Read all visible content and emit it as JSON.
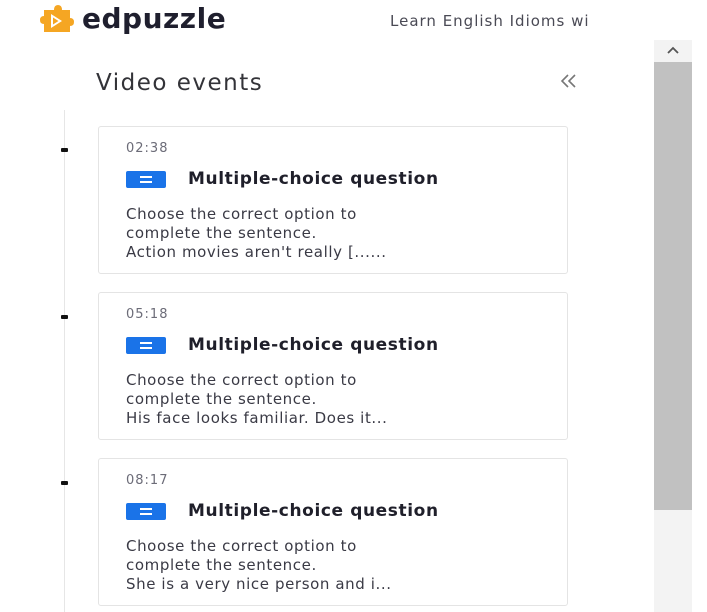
{
  "header": {
    "logo_text": "edpuzzle",
    "video_title": "Learn English Idioms wi"
  },
  "panel": {
    "title": "Video events"
  },
  "events": [
    {
      "time": "02:38",
      "type_label": "Multiple-choice question",
      "line1": "Choose the correct option to",
      "line2": "complete the sentence.",
      "line3": "Action movies aren't really [......"
    },
    {
      "time": "05:18",
      "type_label": "Multiple-choice question",
      "line1": "Choose the correct option to",
      "line2": "complete the sentence.",
      "line3": "His face looks familiar. Does it..."
    },
    {
      "time": "08:17",
      "type_label": "Multiple-choice question",
      "line1": "Choose the correct option to",
      "line2": "complete the sentence.",
      "line3": "She is a very nice person and i..."
    }
  ],
  "icons": {
    "logo": "edpuzzle-puzzle-logo-icon",
    "collapse": "double-chevron-left-icon",
    "question_type": "multiple-choice-icon",
    "scroll_up": "chevron-up-icon"
  },
  "colors": {
    "logo_orange": "#f5a623",
    "question_icon_blue": "#1a73e8"
  }
}
